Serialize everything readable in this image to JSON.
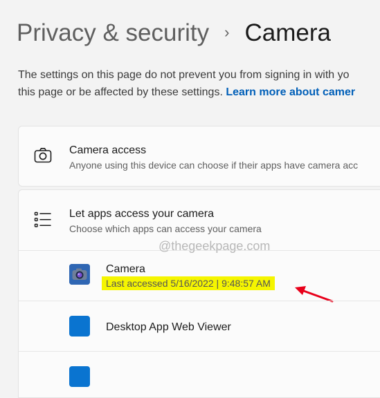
{
  "breadcrumb": {
    "parent": "Privacy & security",
    "separator": "›",
    "current": "Camera"
  },
  "description": {
    "line1": "The settings on this page do not prevent you from signing in with yo",
    "line2": "this page or be affected by these settings.",
    "link": "Learn more about camer"
  },
  "camera_access": {
    "icon": "camera-icon",
    "title": "Camera access",
    "subtitle": "Anyone using this device can choose if their apps have camera acc"
  },
  "let_apps": {
    "icon": "list-icon",
    "title": "Let apps access your camera",
    "subtitle": "Choose which apps can access your camera"
  },
  "watermark": "@thegeekpage.com",
  "apps": [
    {
      "name": "Camera",
      "icon": "camera-app-icon",
      "last_accessed": "Last accessed 5/16/2022  |  9:48:57 AM"
    },
    {
      "name": "Desktop App Web Viewer",
      "icon": "web-viewer-app-icon"
    }
  ],
  "colors": {
    "accent": "#005fb8",
    "highlight": "#f5f500",
    "arrow": "#e8001a",
    "app_icon": "#0a74d0"
  }
}
